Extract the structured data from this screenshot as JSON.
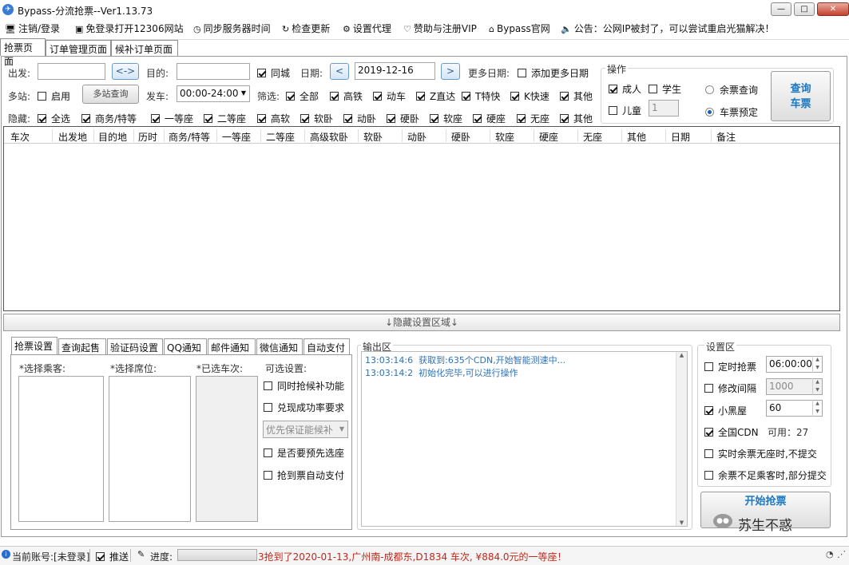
{
  "window": {
    "title": "Bypass-分流抢票--Ver1.13.73",
    "min": "—",
    "max": "□",
    "close": "✕"
  },
  "menu": [
    {
      "icon": "🖥",
      "label": "注销/登录"
    },
    {
      "icon": "▣",
      "label": "免登录打开12306网站"
    },
    {
      "icon": "◷",
      "label": "同步服务器时间"
    },
    {
      "icon": "↻",
      "label": "检查更新"
    },
    {
      "icon": "⚙",
      "label": "设置代理"
    },
    {
      "icon": "♡",
      "label": "赞助与注册VIP"
    },
    {
      "icon": "⌂",
      "label": "Bypass官网"
    },
    {
      "icon": "🔈",
      "label": "公告：公网IP被封了，可以尝试重启光猫解决！"
    }
  ],
  "tabs": [
    "抢票页面",
    "订单管理页面",
    "候补订单页面"
  ],
  "query": {
    "from_label": "出发:",
    "from_value": "",
    "swap_label": "<->",
    "to_label": "目的:",
    "to_value": "",
    "same_city": "同城",
    "date_label": "日期:",
    "prev": "<",
    "date_value": "2019-12-16",
    "next": ">",
    "more_dates_label": "更多日期:",
    "add_more_dates": "添加更多日期",
    "multi_label": "多站:",
    "enable": "启用",
    "multi_query": "多站查询",
    "depart_label": "发车:",
    "depart_value": "00:00-24:00",
    "filter_label": "筛选:",
    "filters": [
      "全部",
      "高铁",
      "动车",
      "Z直达",
      "T特快",
      "K快速",
      "其他"
    ],
    "hide_label": "隐藏:",
    "hides": [
      "全选",
      "商务/特等",
      "一等座",
      "二等座",
      "高软",
      "软卧",
      "动卧",
      "硬卧",
      "软座",
      "硬座",
      "无座",
      "其他"
    ]
  },
  "ops": {
    "title": "操作",
    "adult": "成人",
    "student": "学生",
    "child": "儿童",
    "child_count": "1",
    "remain_query": "余票查询",
    "book": "车票预定",
    "query_btn_1": "查询",
    "query_btn_2": "车票"
  },
  "grid_headers": [
    "车次",
    "出发地",
    "目的地",
    "历时",
    "商务/特等",
    "一等座",
    "二等座",
    "高级软卧",
    "软卧",
    "动卧",
    "硬卧",
    "软座",
    "硬座",
    "无座",
    "其他",
    "日期",
    "备注"
  ],
  "hidden_area": "↓隐藏设置区域↓",
  "settings_tabs": [
    "抢票设置",
    "查询起售",
    "验证码设置",
    "QQ通知",
    "邮件通知",
    "微信通知",
    "自动支付"
  ],
  "settings": {
    "passengers": "*选择乘客:",
    "seats": "*选择席位:",
    "selected_trains": "*已选车次:",
    "optional": "可选设置:",
    "opt1": "同时抢候补功能",
    "opt2": "兑现成功率要求",
    "priority": "优先保证能候补",
    "opt3": "是否要预先选座",
    "opt4": "抢到票自动支付"
  },
  "output": {
    "title": "输出区",
    "lines": [
      {
        "time": "13:03:14:6",
        "text": "获取到:635个CDN,开始智能测速中..."
      },
      {
        "time": "13:03:14:2",
        "text": "初始化完毕,可以进行操作"
      }
    ]
  },
  "config": {
    "title": "设置区",
    "timed": "定时抢票",
    "timed_value": "06:00:00",
    "interval": "修改间隔",
    "interval_value": "1000",
    "blackroom": "小黑屋",
    "blackroom_value": "60",
    "cdn": "全国CDN",
    "cdn_available": "可用：27",
    "realtime": "实时余票无座时,不提交",
    "partial": "余票不足乘客时,部分提交",
    "start": "开始抢票"
  },
  "watermark": "苏生不惑",
  "status": {
    "account": "当前账号:[未登录]",
    "push": "推送",
    "progress_label": "进度:",
    "progress": 0,
    "ticker": "3抢到了2020-01-13,广州南-成都东,D1834 车次, ¥884.0元的一等座！"
  },
  "colors": {
    "accent": "#1a78c2",
    "log": "#2e72b8",
    "ticker": "#c0281c"
  }
}
